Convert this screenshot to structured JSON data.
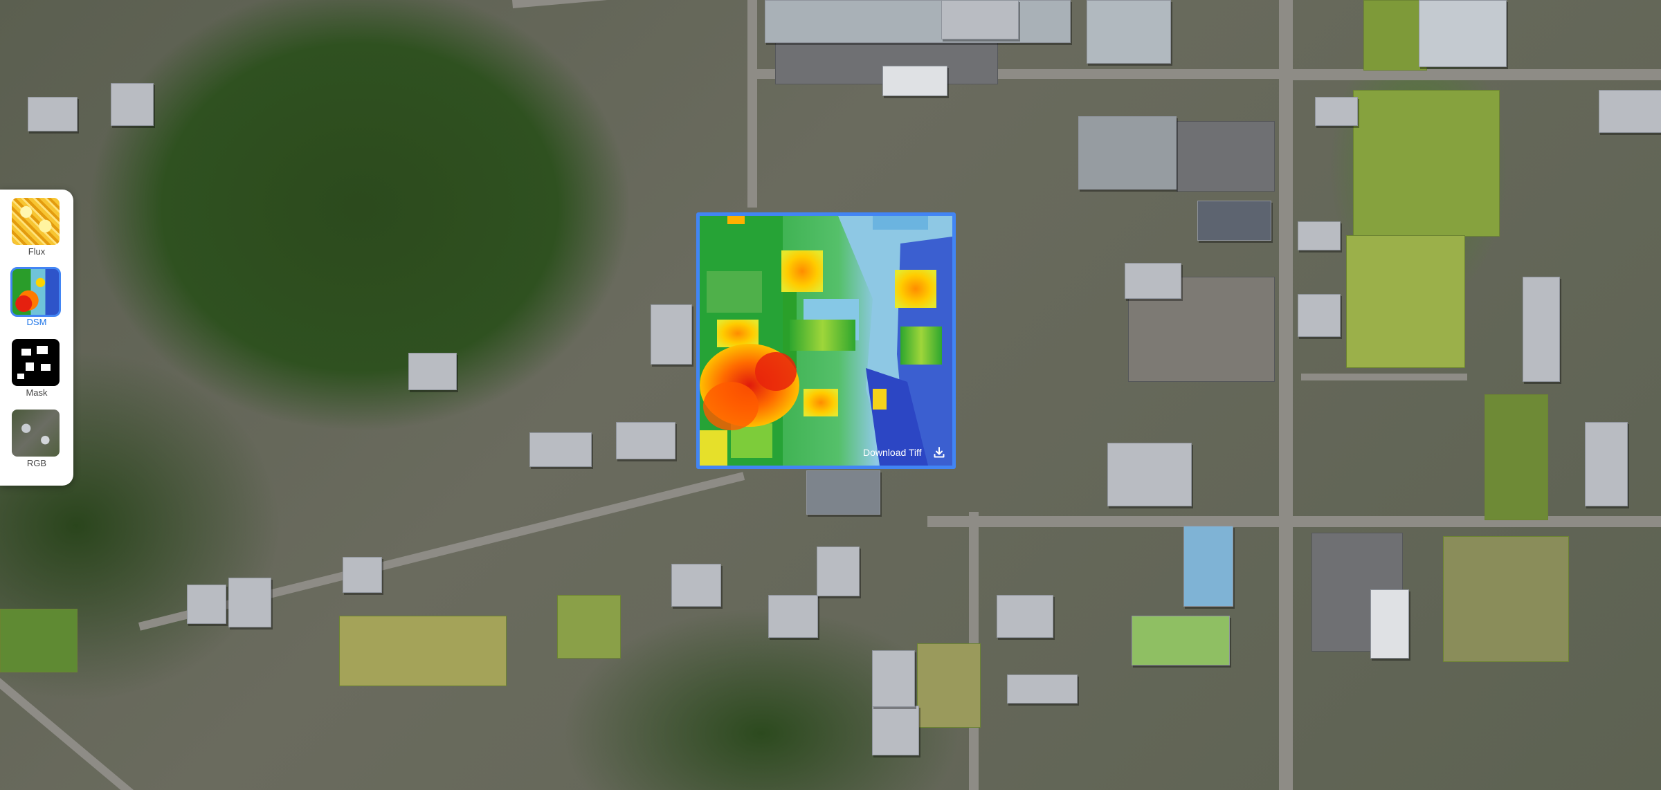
{
  "layers": [
    {
      "id": "flux",
      "label": "Flux",
      "icon": "flux-thumbnail",
      "active": false
    },
    {
      "id": "dsm",
      "label": "DSM",
      "icon": "dsm-thumbnail",
      "active": true
    },
    {
      "id": "mask",
      "label": "Mask",
      "icon": "mask-thumbnail",
      "active": false
    },
    {
      "id": "rgb",
      "label": "RGB",
      "icon": "rgb-thumbnail",
      "active": false
    }
  ],
  "overlay": {
    "download_label": "Download Tiff",
    "download_icon": "download-icon"
  },
  "colors": {
    "accent": "#4285f4",
    "active_label": "#1a73e8",
    "dsm_low": "#2946c6",
    "dsm_mid": "#2aa02a",
    "dsm_high": "#e5200f"
  }
}
